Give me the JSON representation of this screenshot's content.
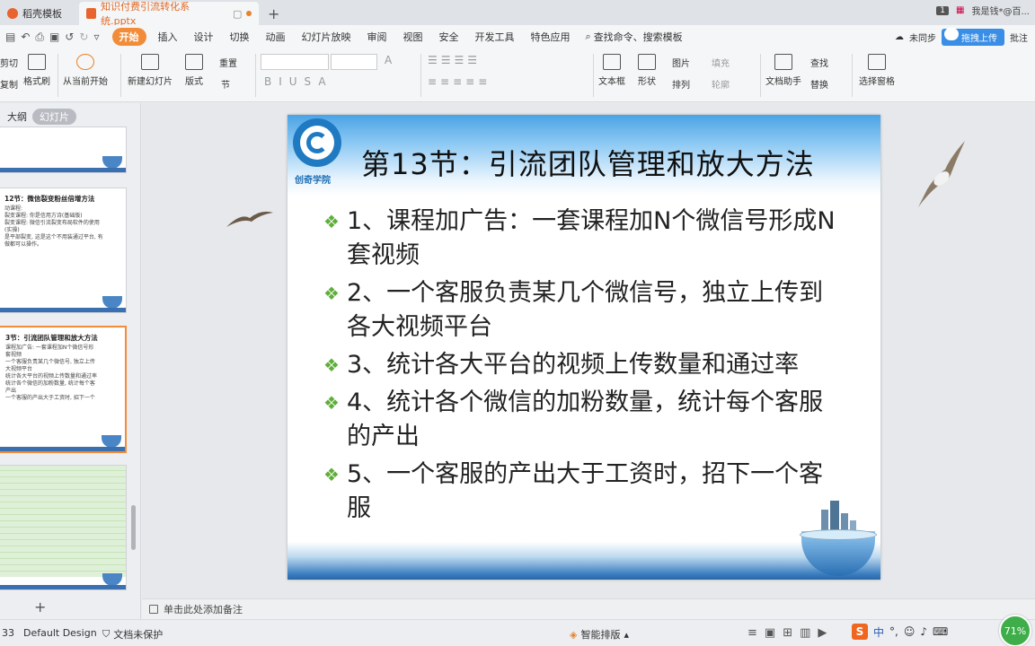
{
  "tabs": [
    {
      "label": "稻壳模板"
    },
    {
      "label": "知识付费引流转化系统.pptx"
    }
  ],
  "tab_right": {
    "page_badge": "1",
    "user_label": "我是钱*@百..."
  },
  "menu": {
    "items": [
      "开始",
      "插入",
      "设计",
      "切换",
      "动画",
      "幻灯片放映",
      "审阅",
      "视图",
      "安全",
      "开发工具",
      "特色应用"
    ],
    "search_label": "查找命令、搜索模板",
    "right_status": "未同步",
    "upload_label": "拖拽上传",
    "share_label": "批注"
  },
  "ribbon": {
    "cut": "剪切",
    "copy": "复制",
    "format_painter": "格式刷",
    "play_from_current": "从当前开始",
    "new_slide": "新建幻灯片",
    "layout": "版式",
    "section": "节",
    "reset": "重置",
    "text_box": "文本框",
    "shape": "形状",
    "picture": "图片",
    "fill": "填充",
    "arrange": "排列",
    "outline": "轮廓",
    "doc_helper": "文档助手",
    "find": "查找",
    "replace": "替换",
    "select_pane": "选择窗格"
  },
  "left_panel": {
    "tab_outline": "大纲",
    "tab_slides": "幻灯片",
    "thumbs": [
      {
        "title": "12节：微信裂变粉丝倍增方法",
        "lines": [
          "动课程:",
          "裂变课程: 你是信用方诗(基础版)",
          "裂变课程: 微信引流裂变布局软件的使用",
          "(实操)",
          "",
          "是平部裂变, 这是这个不用装通过平台, 有",
          "做都可以操作。"
        ]
      },
      {
        "title": "3节：引流团队管理和放大方法",
        "lines": [
          "课程加广告: 一套课程加N个微信号形",
          "套视频",
          "一个客服负责某几个微信号, 独立上传",
          "大视频平台",
          "统计各大平台的视频上传数量和通过率",
          "统计各个微信的加粉数量, 统计每个客",
          "产出",
          "一个客服的产出大于工资时, 招下一个"
        ]
      }
    ],
    "add_label": "+"
  },
  "slide": {
    "logo_text": "创奇学院",
    "title": "第13节：引流团队管理和放大方法",
    "bullets": [
      "1、课程加广告：一套课程加N个微信号形成N套视频",
      "2、一个客服负责某几个微信号，独立上传到各大视频平台",
      "3、统计各大平台的视频上传数量和通过率",
      "4、统计各个微信的加粉数量，统计每个客服的产出",
      "5、一个客服的产出大于工资时，招下一个客服"
    ],
    "bullet_mark": "❖"
  },
  "notes": {
    "placeholder": "单击此处添加备注"
  },
  "status": {
    "slide_num": "33",
    "theme": "Default Design",
    "protect": "文档未保护",
    "smart": "智能排版",
    "zoom": "71%",
    "ime": "中"
  },
  "colors": {
    "accent": "#f28c38",
    "bullet": "#5fae3a",
    "brand_blue": "#1f7ac2"
  }
}
